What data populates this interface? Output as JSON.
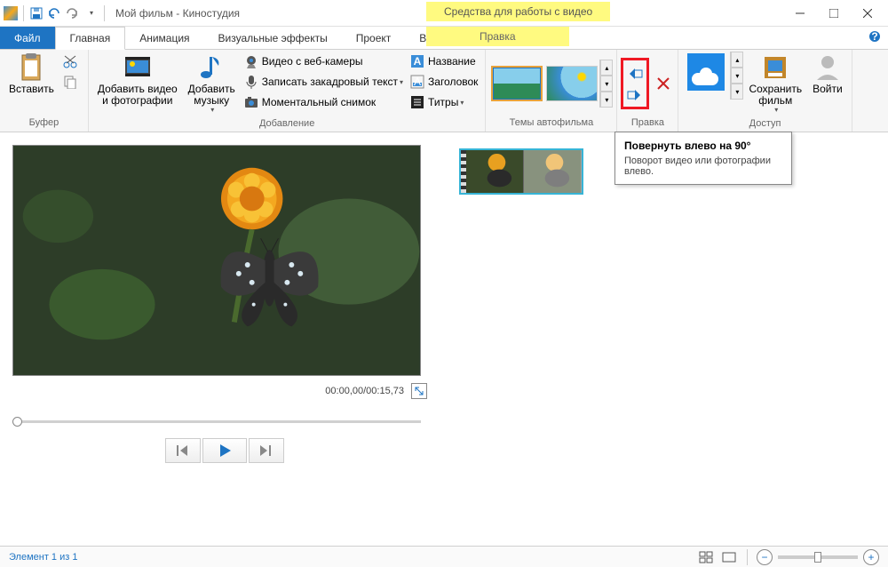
{
  "titlebar": {
    "title": "Мой фильм - Киностудия",
    "contextual_label": "Средства для работы с видео"
  },
  "tabs": {
    "file": "Файл",
    "home": "Главная",
    "animation": "Анимация",
    "visual_fx": "Визуальные эффекты",
    "project": "Проект",
    "view": "Вид",
    "edit_ctx": "Правка"
  },
  "ribbon": {
    "buffer": {
      "label": "Буфер",
      "paste": "Вставить"
    },
    "add": {
      "label": "Добавление",
      "add_video": "Добавить видео\nи фотографии",
      "add_music": "Добавить\nмузыку",
      "webcam": "Видео с веб-камеры",
      "voiceover": "Записать закадровый текст",
      "snapshot": "Моментальный снимок",
      "title": "Название",
      "caption": "Заголовок",
      "credits": "Титры"
    },
    "themes": {
      "label": "Темы автофильма"
    },
    "edit": {
      "label": "Правка"
    },
    "access": {
      "label": "Доступ",
      "save_movie": "Сохранить\nфильм",
      "signin": "Войти"
    }
  },
  "preview": {
    "time": "00:00,00/00:15,73"
  },
  "tooltip": {
    "title": "Повернуть влево на 90°",
    "desc": "Поворот видео или фотографии влево."
  },
  "statusbar": {
    "item_count": "Элемент 1 из 1"
  }
}
